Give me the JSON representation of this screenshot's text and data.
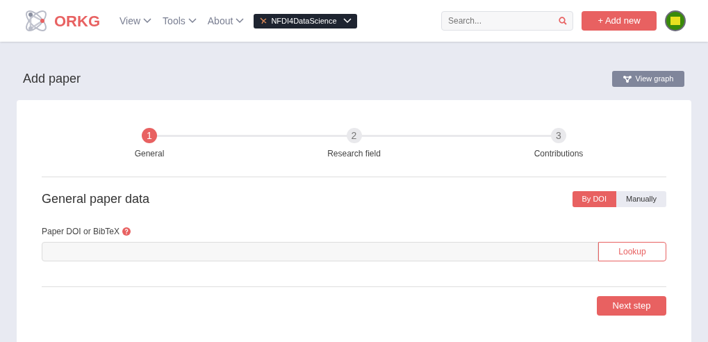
{
  "header": {
    "logo": "ORKG",
    "nav": [
      {
        "label": "View"
      },
      {
        "label": "Tools"
      },
      {
        "label": "About"
      }
    ],
    "observatory": "NFDI4DataScience",
    "search": {
      "placeholder": "Search..."
    },
    "add_button": "+ Add new"
  },
  "page": {
    "title": "Add paper",
    "view_graph": "View graph"
  },
  "steps": [
    {
      "number": "1",
      "label": "General",
      "selected": true
    },
    {
      "number": "2",
      "label": "Research field",
      "selected": false
    },
    {
      "number": "3",
      "label": "Contributions",
      "selected": false
    }
  ],
  "section": {
    "title": "General paper data",
    "modes": [
      {
        "label": "By DOI",
        "selected": true
      },
      {
        "label": "Manually",
        "selected": false
      }
    ],
    "field_label": "Paper DOI or BibTeX",
    "lookup": "Lookup",
    "next": "Next step"
  }
}
